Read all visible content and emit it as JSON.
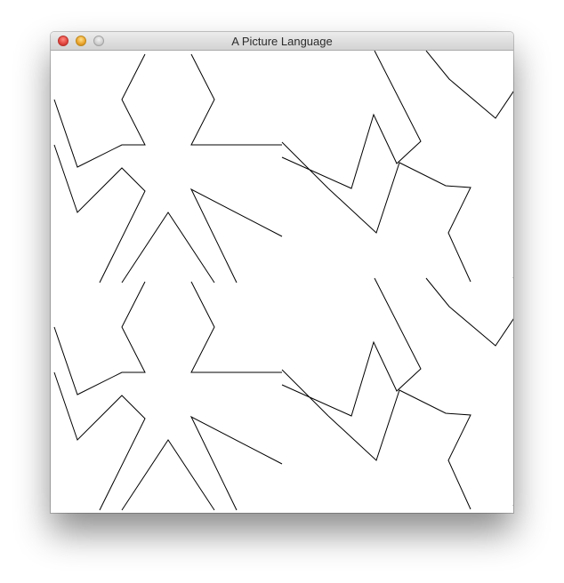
{
  "window": {
    "title": "A Picture Language",
    "buttons": [
      {
        "name": "close-button",
        "color": "#e0443e"
      },
      {
        "name": "minimize-button",
        "color": "#e9a22a"
      },
      {
        "name": "zoom-button",
        "color": "#cfcfcf"
      }
    ]
  },
  "canvas": {
    "background": "#ffffff",
    "stroke": "#000000"
  }
}
